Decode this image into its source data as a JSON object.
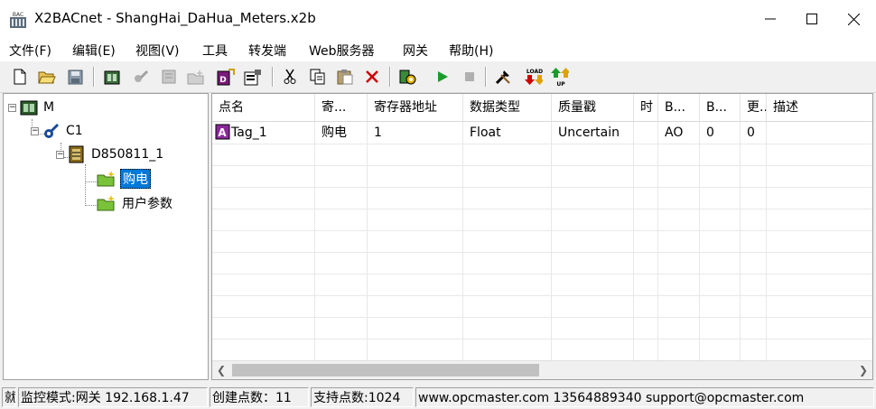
{
  "window": {
    "title": "X2BACnet - ShangHai_DaHua_Meters.x2b",
    "icon_text": "BAC"
  },
  "menu": [
    "文件(F)",
    "编辑(E)",
    "视图(V)",
    "工具",
    "转发端",
    "Web服务器",
    "网关",
    "帮助(H)"
  ],
  "toolbar_icons": [
    "new-icon",
    "open-icon",
    "save-icon",
    "add-device-icon",
    "add-channel-icon",
    "add-tag-icon",
    "add-group-icon",
    "device-props-icon",
    "properties-icon",
    "cut-icon",
    "copy-icon",
    "paste-icon",
    "delete-icon",
    "monitor-icon",
    "run-icon",
    "stop-icon",
    "tools-icon",
    "load-icon",
    "upload-icon"
  ],
  "tree": {
    "root": "M",
    "channel": "C1",
    "device": "D850811_1",
    "groups": [
      "购电",
      "用户参数"
    ],
    "selected": "购电"
  },
  "table": {
    "columns": [
      "点名",
      "寄...",
      "寄存器地址",
      "数据类型",
      "质量戳",
      "时",
      "B...",
      "B...",
      "更...",
      "描述"
    ],
    "rows": [
      {
        "name": "Tag_1",
        "reg": "购电",
        "addr": "1",
        "type": "Float",
        "quality": "Uncertain",
        "time": "",
        "b1": "AO",
        "b2": "0",
        "upd": "0",
        "desc": ""
      }
    ]
  },
  "status": {
    "pane0": "就",
    "mode": "监控模式:网关 192.168.1.47",
    "created": "创建点数：11",
    "supported": "支持点数:1024",
    "contact": "www.opcmaster.com 13564889340 support@opcmaster.com"
  },
  "colors": {
    "selection": "#0078d7",
    "run": "#1a9a2a",
    "delete": "#d00000"
  }
}
